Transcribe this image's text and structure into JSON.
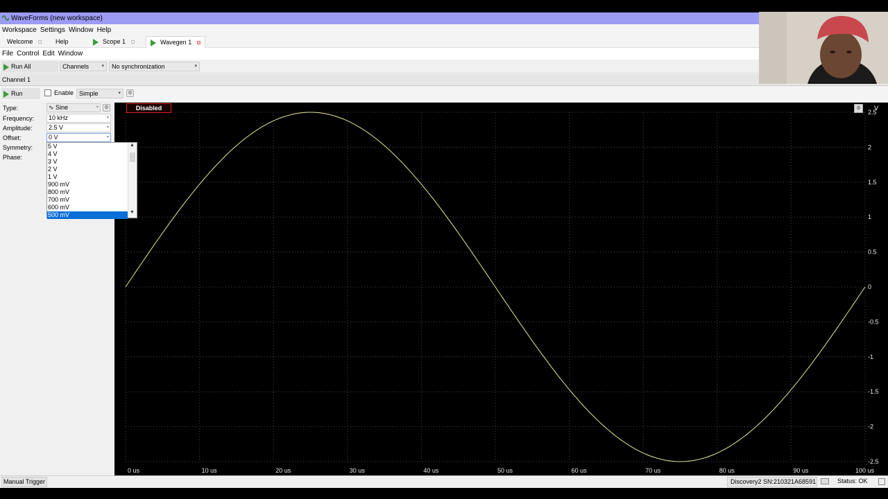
{
  "window": {
    "title": "WaveForms (new workspace)"
  },
  "menubar": [
    "Workspace",
    "Settings",
    "Window",
    "Help"
  ],
  "tabs": [
    {
      "label": "Welcome"
    },
    {
      "label": "Help"
    },
    {
      "label": "Scope 1"
    },
    {
      "label": "Wavegen 1"
    }
  ],
  "instrument_menu": [
    "File",
    "Control",
    "Edit",
    "Window"
  ],
  "toolbar": {
    "run_all": "Run All",
    "channels": "Channels",
    "sync": "No synchronization"
  },
  "channel": {
    "header": "Channel 1",
    "run": "Run",
    "enable": "Enable",
    "mode": "Simple"
  },
  "params": {
    "type_label": "Type:",
    "type_value": "Sine",
    "frequency_label": "Frequency:",
    "frequency_value": "10 kHz",
    "amplitude_label": "Amplitude:",
    "amplitude_value": "2.5 V",
    "offset_label": "Offset:",
    "offset_value": "0 V",
    "symmetry_label": "Symmetry:",
    "phase_label": "Phase:"
  },
  "offset_dropdown": {
    "options": [
      "5 V",
      "4 V",
      "3 V",
      "2 V",
      "1 V",
      "900 mV",
      "800 mV",
      "700 mV",
      "600 mV",
      "500 mV"
    ],
    "selected": "500 mV"
  },
  "plot": {
    "badge": "Disabled",
    "unit": "V",
    "trace_color": "#e8e89a"
  },
  "chart_data": {
    "type": "line",
    "x_ticks": [
      "0 us",
      "10 us",
      "20 us",
      "30 us",
      "40 us",
      "50 us",
      "60 us",
      "70 us",
      "80 us",
      "90 us",
      "100 us"
    ],
    "y_ticks": [
      "2.5",
      "2",
      "1.5",
      "1",
      "0.5",
      "0",
      "-0.5",
      "-1",
      "-1.5",
      "-2",
      "-2.5"
    ],
    "xlim": [
      0,
      100
    ],
    "ylim": [
      -2.5,
      2.5
    ],
    "series": [
      {
        "function": "sine",
        "amplitude": 2.5,
        "period_us": 100,
        "offset": 0
      }
    ]
  },
  "statusbar": {
    "trigger": "Manual Trigger",
    "device": "Discovery2 SN:210321A68591",
    "status": "Status: OK"
  }
}
